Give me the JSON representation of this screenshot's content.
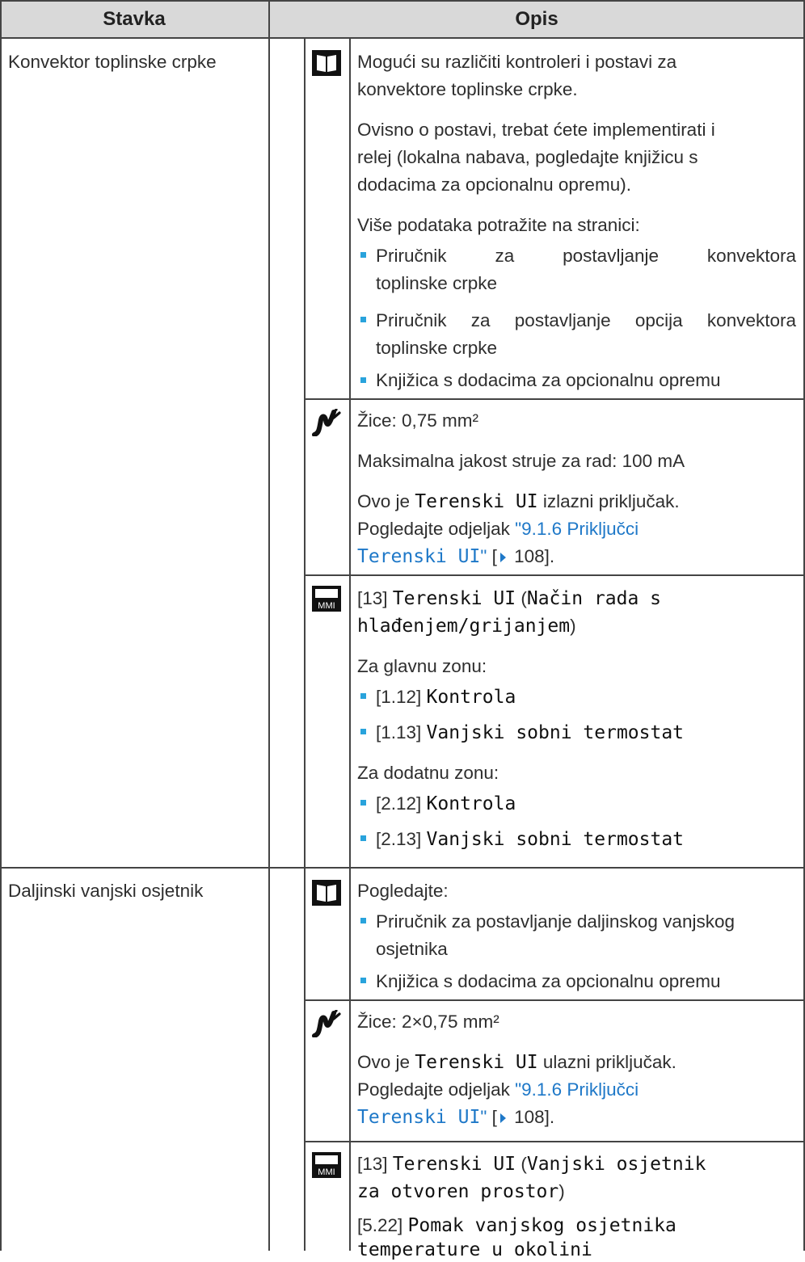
{
  "header": {
    "col1": "Stavka",
    "col2": "Opis"
  },
  "rows": {
    "r1": {
      "item": "Konvektor toplinske crpke",
      "book": {
        "p1": [
          "Mogući su različiti kontroleri i postavi za",
          "konvektore toplinske crpke."
        ],
        "p2": [
          "Ovisno o postavi, trebat ćete implementirati i",
          "relej (lokalna nabava, pogledajte knjižicu s",
          "dodacima za opcionalnu opremu)."
        ],
        "p3": "Više podataka potražite na stranici:",
        "b1": [
          "Priručnik za postavljanje konvektora",
          "toplinske crpke"
        ],
        "b2": [
          "Priručnik za postavljanje opcija konvektora",
          "toplinske crpke"
        ],
        "b3": "Knjižica s dodacima za opcionalnu opremu"
      },
      "wire": {
        "p1": "Žice: 0,75 mm²",
        "p2": "Maksimalna jakost struje za rad: 100 mA",
        "p3a": "Ovo je ",
        "p3b": "Terenski UI",
        "p3c": " izlazni priključak.",
        "p4a": "Pogledajte odjeljak ",
        "p4b": "\"9.1.6 Priključci",
        "p5a": "Terenski UI",
        "p5b": "\"",
        "p5c": " [",
        "p5d": " 108]."
      },
      "mmi": {
        "l1a": "[13] ",
        "l1b": "Terenski UI",
        "l1c": " (",
        "l1d": "Način rada s",
        "l2a": "hlađenjem/grijanjem",
        "l2b": ")",
        "p2": "Za glavnu zonu:",
        "b1a": "[1.12] ",
        "b1b": "Kontrola",
        "b2a": "[1.13] ",
        "b2b": "Vanjski sobni termostat",
        "p3": "Za dodatnu zonu:",
        "b3a": "[2.12] ",
        "b3b": "Kontrola",
        "b4a": "[2.13] ",
        "b4b": "Vanjski sobni termostat"
      }
    },
    "r2": {
      "item": "Daljinski vanjski osjetnik",
      "book": {
        "p1": "Pogledajte:",
        "b1": [
          "Priručnik za postavljanje daljinskog vanjskog",
          "osjetnika"
        ],
        "b2": "Knjižica s dodacima za opcionalnu opremu"
      },
      "wire": {
        "p1": "Žice: 2×0,75 mm²",
        "p2a": "Ovo je ",
        "p2b": "Terenski UI",
        "p2c": " ulazni priključak.",
        "p3a": "Pogledajte odjeljak ",
        "p3b": "\"9.1.6 Priključci",
        "p4a": "Terenski UI",
        "p4b": "\"",
        "p4c": " [",
        "p4d": " 108]."
      },
      "mmi": {
        "l1a": "[13] ",
        "l1b": "Terenski UI",
        "l1c": " (",
        "l1d": "Vanjski osjetnik",
        "l2a": "za otvoren prostor",
        "l2b": ")",
        "l3a": "[5.22] ",
        "l3b": "Pomak vanjskog osjetnika",
        "l4": "temperature u okolini"
      }
    }
  },
  "icons": {
    "book": "book-icon",
    "wire": "wire-icon",
    "mmi": "mmi-icon",
    "mmi_label": "MMI"
  },
  "colors": {
    "header_bg": "#d9d9d9",
    "link": "#1e78c8",
    "bullet": "#29a3dc"
  }
}
